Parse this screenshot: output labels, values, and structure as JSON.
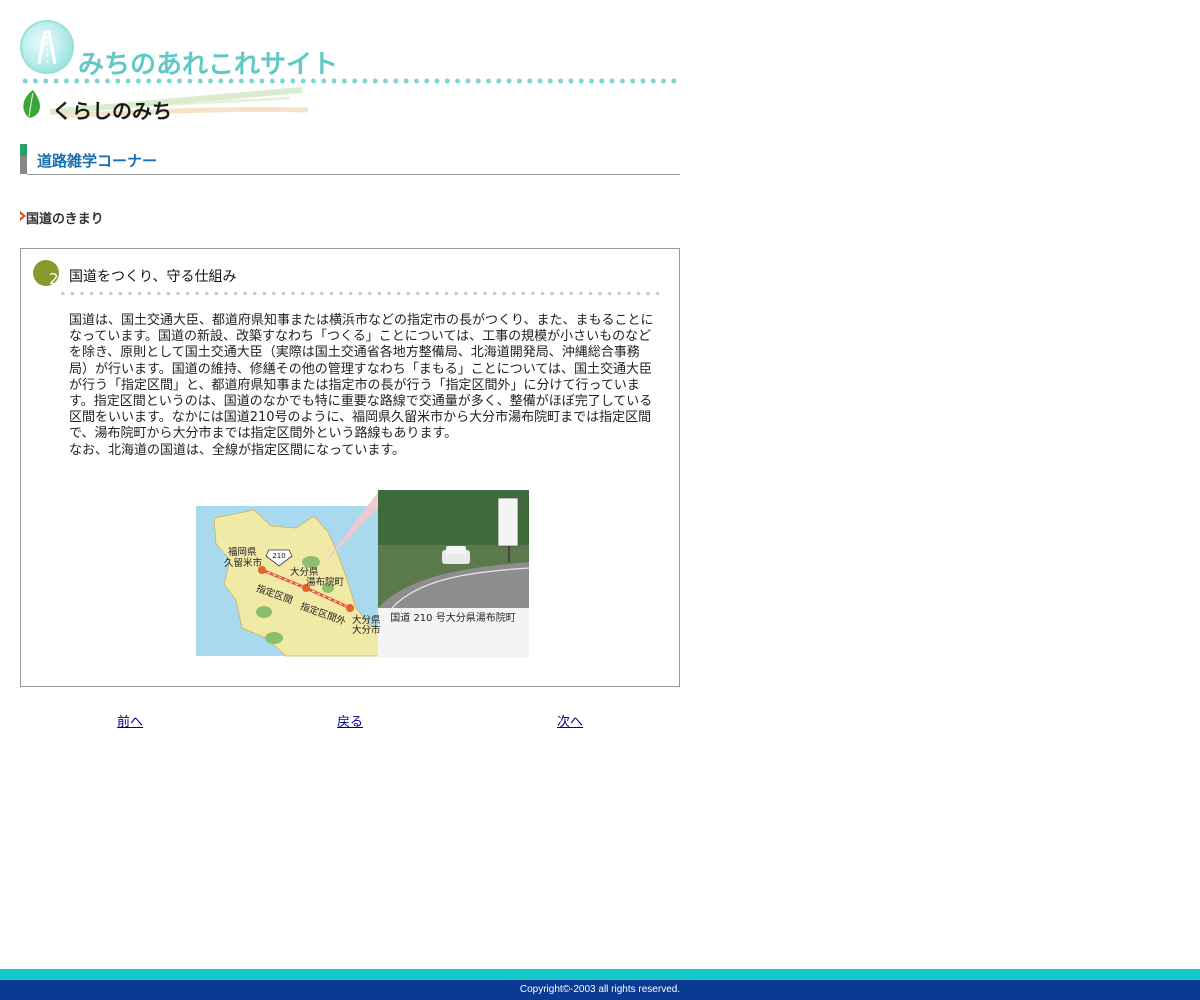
{
  "header": {
    "site_title": "みちのあれこれサイト",
    "section_title": "くらしのみち"
  },
  "corner": {
    "title": "道路雑学コーナー"
  },
  "topic": {
    "label": "国道のきまり"
  },
  "content": {
    "number": "2",
    "title": "国道をつくり、守る仕組み",
    "paragraphs": [
      "国道は、国土交通大臣、都道府県知事または横浜市などの指定市の長がつくり、また、まもることになっています。国道の新設、改築すなわち「つくる」ことについては、工事の規模が小さいものなどを除き、原則として国土交通大臣（実際は国土交通省各地方整備局、北海道開発局、沖縄総合事務局）が行います。国道の維持、修繕その他の管理すなわち「まもる」ことについては、国土交通大臣が行う「指定区間」と、都道府県知事または指定市の長が行う「指定区間外」に分けて行っています。指定区間というのは、国道のなかでも特に重要な路線で交通量が多く、整備がほぼ完了している区間をいいます。なかには国道210号のように、福岡県久留米市から大分市湯布院町までは指定区間で、湯布院町から大分市までは指定区間外という路線もあります。",
      "なお、北海道の国道は、全線が指定区間になっています。"
    ]
  },
  "figure": {
    "caption": "国道 210 号大分県湯布院町",
    "route_number": "210",
    "labels": {
      "fukuoka": "福岡県",
      "kurume": "久留米市",
      "oita_pref": "大分県",
      "yufuin": "湯布院町",
      "designated": "指定区間",
      "non_designated": "指定区間外",
      "oita_pref2": "大分県",
      "oita_city": "大分市"
    }
  },
  "nav": {
    "prev": "前へ",
    "back": "戻る",
    "next": "次へ"
  },
  "footer": {
    "copyright": "Copyright©-2003 all rights reserved."
  },
  "colors": {
    "accent_teal": "#5ec9c6",
    "heading_blue": "#1a6fb0",
    "badge_olive": "#8a9a2a",
    "footer_teal": "#14c9c9",
    "footer_blue": "#0b3a93",
    "link": "#00008b"
  }
}
